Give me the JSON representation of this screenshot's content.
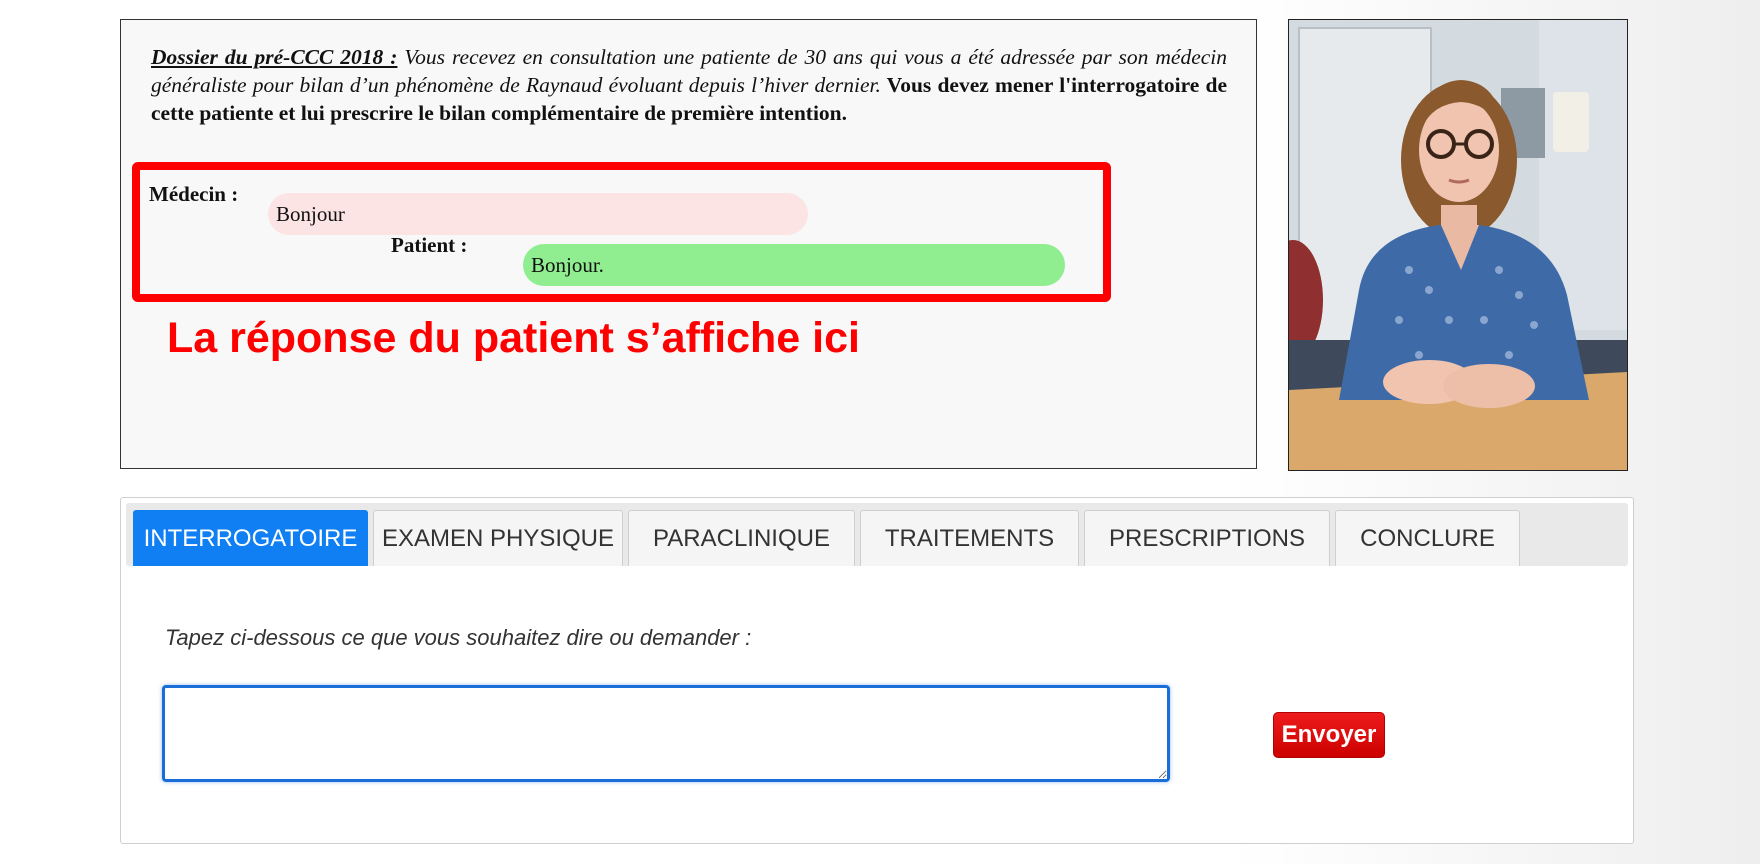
{
  "case": {
    "label": "Dossier du pré-CCC 2018 :",
    "description": " Vous recevez en consultation une patiente de 30 ans qui vous a été adressée par son médecin généraliste pour bilan d’un phénomène de Raynaud évoluant depuis l’hiver dernier.",
    "instruction": " Vous devez mener l'interrogatoire de cette patiente et lui prescrire le bilan complémentaire de première intention."
  },
  "dialog": {
    "doctor_label": "Médecin :",
    "doctor_message": "Bonjour",
    "patient_label": "Patient :",
    "patient_message": "Bonjour."
  },
  "annotation": "La réponse du patient s’affiche ici",
  "tabs": [
    {
      "label": "INTERROGATOIRE",
      "active": true
    },
    {
      "label": "EXAMEN PHYSIQUE",
      "active": false
    },
    {
      "label": "PARACLINIQUE",
      "active": false
    },
    {
      "label": "TRAITEMENTS",
      "active": false
    },
    {
      "label": "PRESCRIPTIONS",
      "active": false
    },
    {
      "label": "CONCLURE",
      "active": false
    }
  ],
  "interrogatoire": {
    "prompt": "Tapez ci-dessous ce que vous souhaitez dire ou demander :",
    "input_value": "",
    "send_label": "Envoyer"
  },
  "colors": {
    "accent_blue": "#0f7ff3",
    "send_red": "#cc0000",
    "annotation_red": "#ff0000",
    "doctor_bubble": "#fde4e4",
    "patient_bubble": "#90ee90"
  }
}
